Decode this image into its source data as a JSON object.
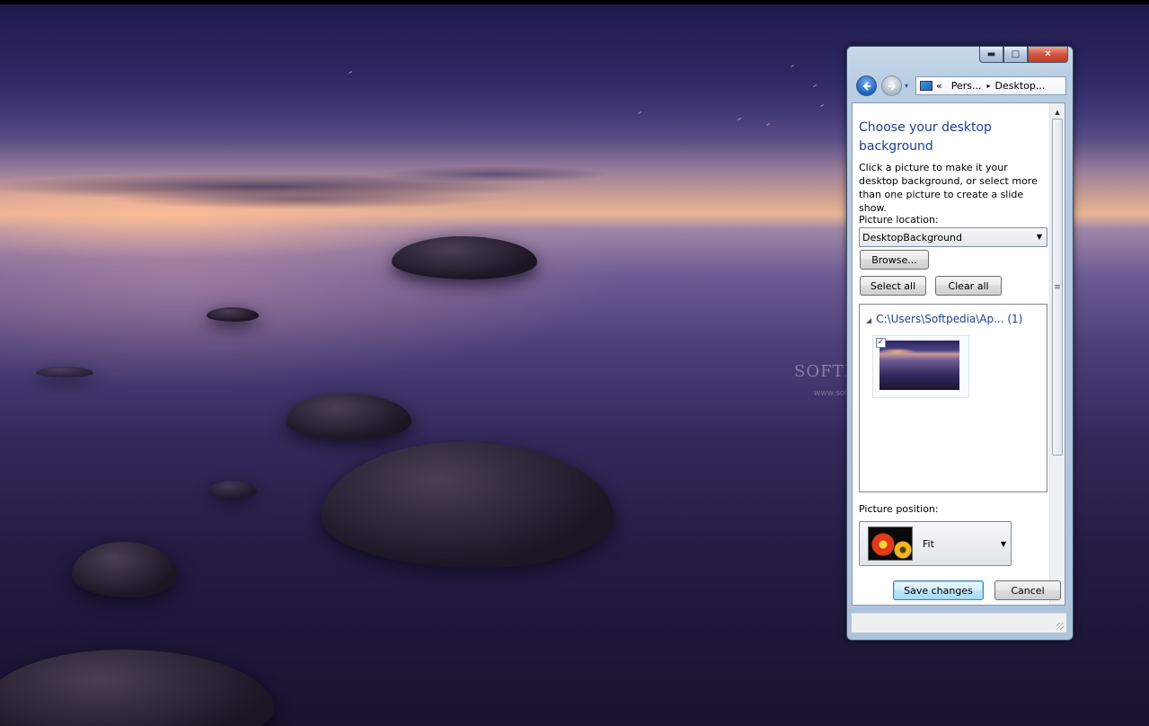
{
  "window": {
    "controls": {
      "minimize": "▬",
      "maximize": "□",
      "close": "✕"
    },
    "nav": {
      "back_icon": "arrow-left-icon",
      "forward_icon": "arrow-right-icon",
      "recent_icon": "▾"
    },
    "address": {
      "prefix": "«",
      "crumbs": [
        "Pers...",
        "Desktop..."
      ],
      "separator": "▸"
    },
    "title": "Choose your desktop background",
    "description": "Click a picture to make it your desktop background, or select more than one picture to create a slide show.",
    "picture_location": {
      "label": "Picture location:",
      "value": "DesktopBackground"
    },
    "buttons": {
      "browse": "Browse...",
      "select_all": "Select all",
      "clear_all": "Clear all",
      "save": "Save changes",
      "cancel": "Cancel"
    },
    "picture_group": {
      "header": "C:\\Users\\Softpedia\\Ap... (1)",
      "thumbnail_checked": "✓"
    },
    "picture_position": {
      "label": "Picture position:",
      "value": "Fit"
    },
    "scroll": {
      "up": "▲",
      "down": "▼",
      "grip": "≡"
    }
  },
  "desktop": {
    "watermark": "SOFTPEDIA",
    "watermark_url": "www.softpedia.com"
  },
  "colors": {
    "accent_title": "#1e3e91",
    "close_button": "#c63a22",
    "default_button_border": "#3c7fb1"
  }
}
